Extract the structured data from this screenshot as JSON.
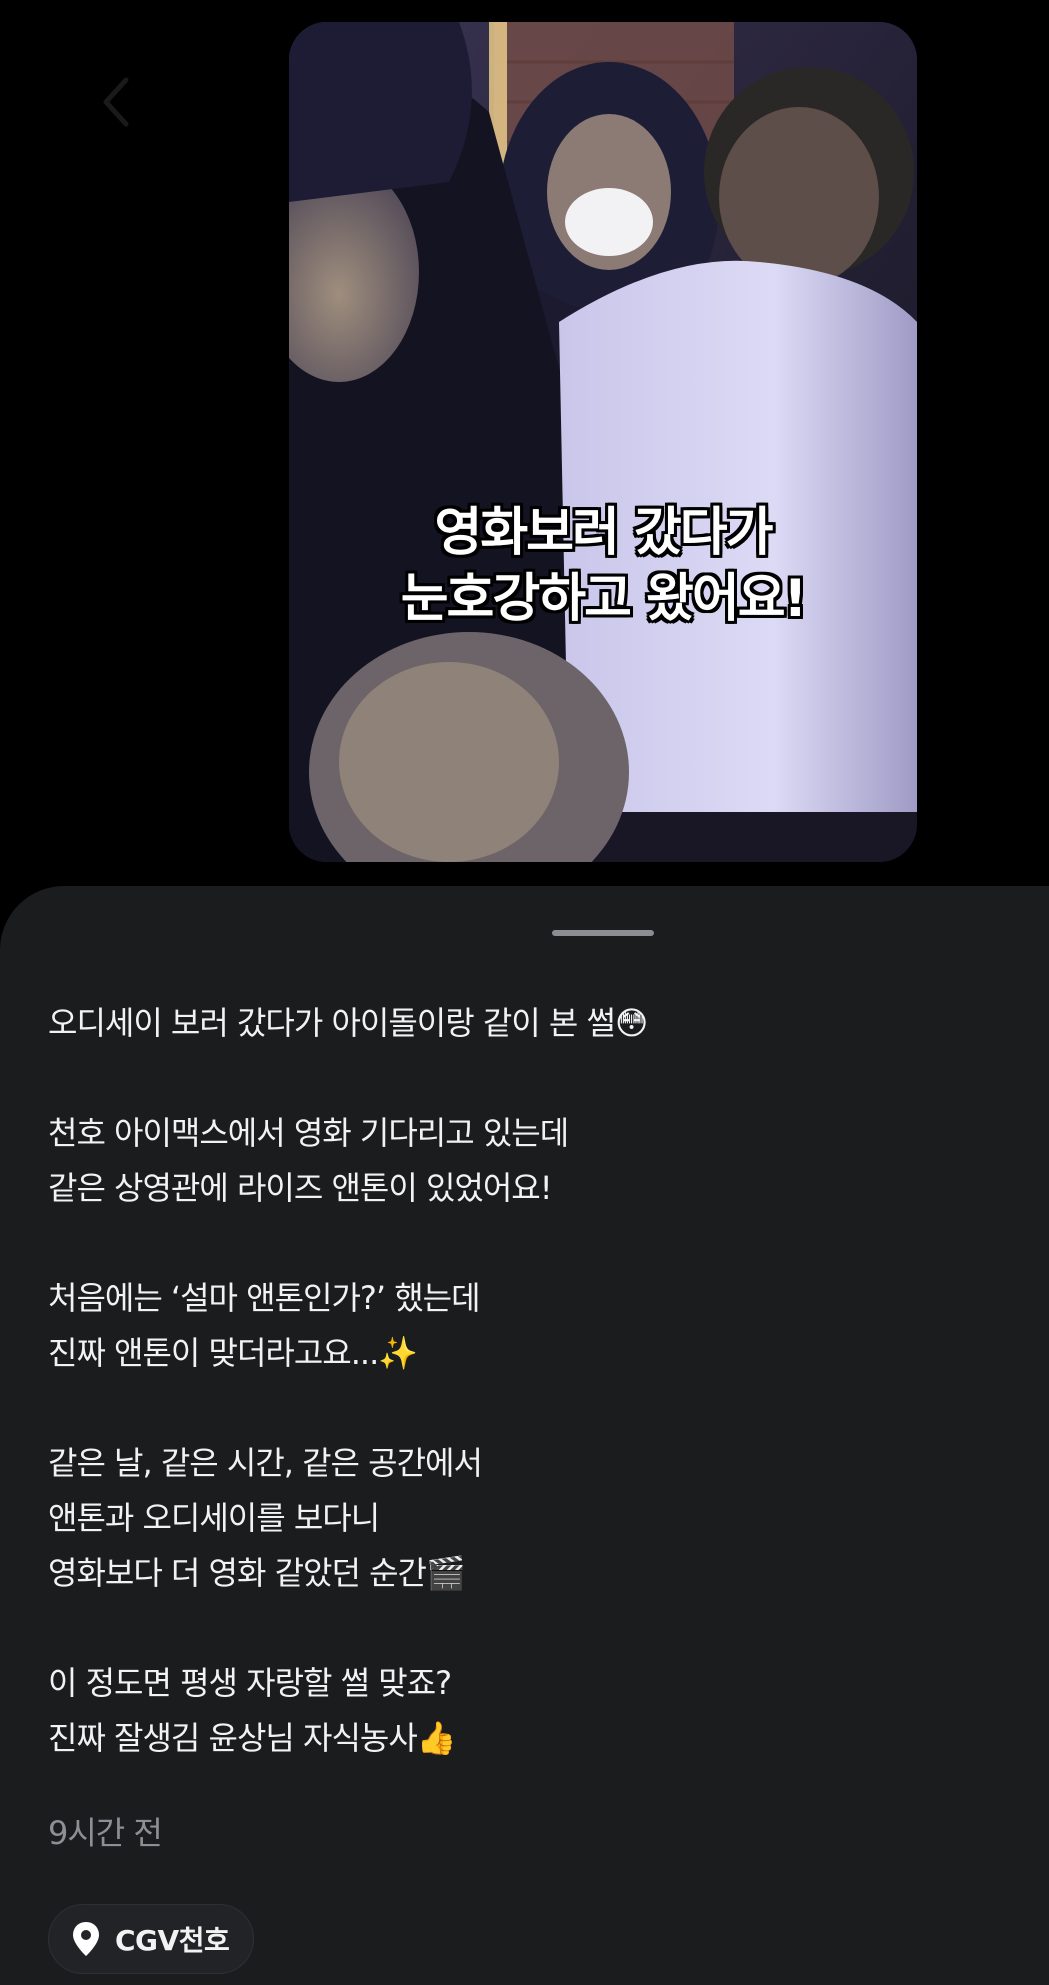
{
  "video": {
    "caption_line1": "영화보러 갔다가",
    "caption_line2": "눈호강하고 왔어요!"
  },
  "post": {
    "paragraphs": [
      [
        "오디세이 보러 갔다가 아이돌이랑 같이 본 썰😳"
      ],
      [
        "천호 아이맥스에서 영화 기다리고 있는데",
        "같은 상영관에 라이즈 앤톤이 있었어요!"
      ],
      [
        "처음에는 ‘설마 앤톤인가?’ 했는데",
        "진짜 앤톤이 맞더라고요...✨"
      ],
      [
        "같은 날, 같은 시간, 같은 공간에서",
        "앤톤과 오디세이를 보다니",
        "영화보다 더 영화 같았던 순간🎬"
      ],
      [
        "이 정도면 평생 자랑할 썰 맞죠?",
        "진짜 잘생김 윤상님 자식농사👍"
      ]
    ],
    "timestamp": "9시간 전",
    "location": "CGV천호"
  },
  "icons": {
    "back": "chevron-left-icon",
    "location": "map-pin-icon"
  },
  "colors": {
    "background": "#000000",
    "sheet": "#1b1c1e",
    "text": "#f2f2f2",
    "muted": "#8c8f94",
    "chip": "#222326"
  }
}
